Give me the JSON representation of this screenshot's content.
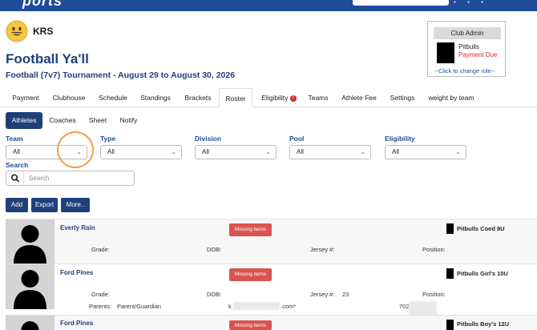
{
  "header": {
    "brand": "ports"
  },
  "org": {
    "name": "KRS"
  },
  "page": {
    "title": "Football Ya'll",
    "subtitle": "Football (7v7) Tournament  -  August 29 to August 30, 2026"
  },
  "club_admin": {
    "header": "Club Admin",
    "club_name": "Pitbulls",
    "status": "Payment Due",
    "change_role": "--Click to change role--"
  },
  "tabs": [
    {
      "label": "Payment"
    },
    {
      "label": "Clubhouse"
    },
    {
      "label": "Schedule"
    },
    {
      "label": "Standings"
    },
    {
      "label": "Brackets"
    },
    {
      "label": "Roster",
      "active": true
    },
    {
      "label": "Eligibility",
      "badge": "!"
    },
    {
      "label": "Teams"
    },
    {
      "label": "Athlete Fee"
    },
    {
      "label": "Settings"
    },
    {
      "label": "weight by team"
    }
  ],
  "subtabs": [
    {
      "label": "Athletes",
      "active": true
    },
    {
      "label": "Coaches"
    },
    {
      "label": "Sheet"
    },
    {
      "label": "Notify"
    }
  ],
  "filters": {
    "team": {
      "label": "Team",
      "value": "All"
    },
    "type": {
      "label": "Type",
      "value": "All"
    },
    "division": {
      "label": "Division",
      "value": "All"
    },
    "pool": {
      "label": "Pool",
      "value": "All"
    },
    "eligibility": {
      "label": "Eligibility",
      "value": "All"
    }
  },
  "search": {
    "label": "Search",
    "placeholder": "Search"
  },
  "actions": {
    "add": "Add",
    "export": "Export",
    "more": "More.."
  },
  "athletes": [
    {
      "name": "Everly Rain",
      "status": "Missing items",
      "team": "Pitbulls Coed 8U",
      "grade_label": "Grade:",
      "dob_label": "DOB:",
      "jersey_label": "Jersey #:",
      "jersey": "",
      "position_label": "Position:"
    },
    {
      "name": "Ford Pines",
      "status": "Missing items",
      "team": "Pitbulls Girl's 10U",
      "grade_label": "Grade:",
      "dob_label": "DOB:",
      "jersey_label": "Jersey #:",
      "jersey": "23",
      "position_label": "Position:",
      "parents_label": "Parents:",
      "parents_value": "Parent/Guardian",
      "email_start": "k",
      "email_end": ".com*",
      "phone_start": "702"
    },
    {
      "name": "Ford Pines",
      "status": "Missing items",
      "team": "Pitbulls Boy's 12U"
    }
  ]
}
